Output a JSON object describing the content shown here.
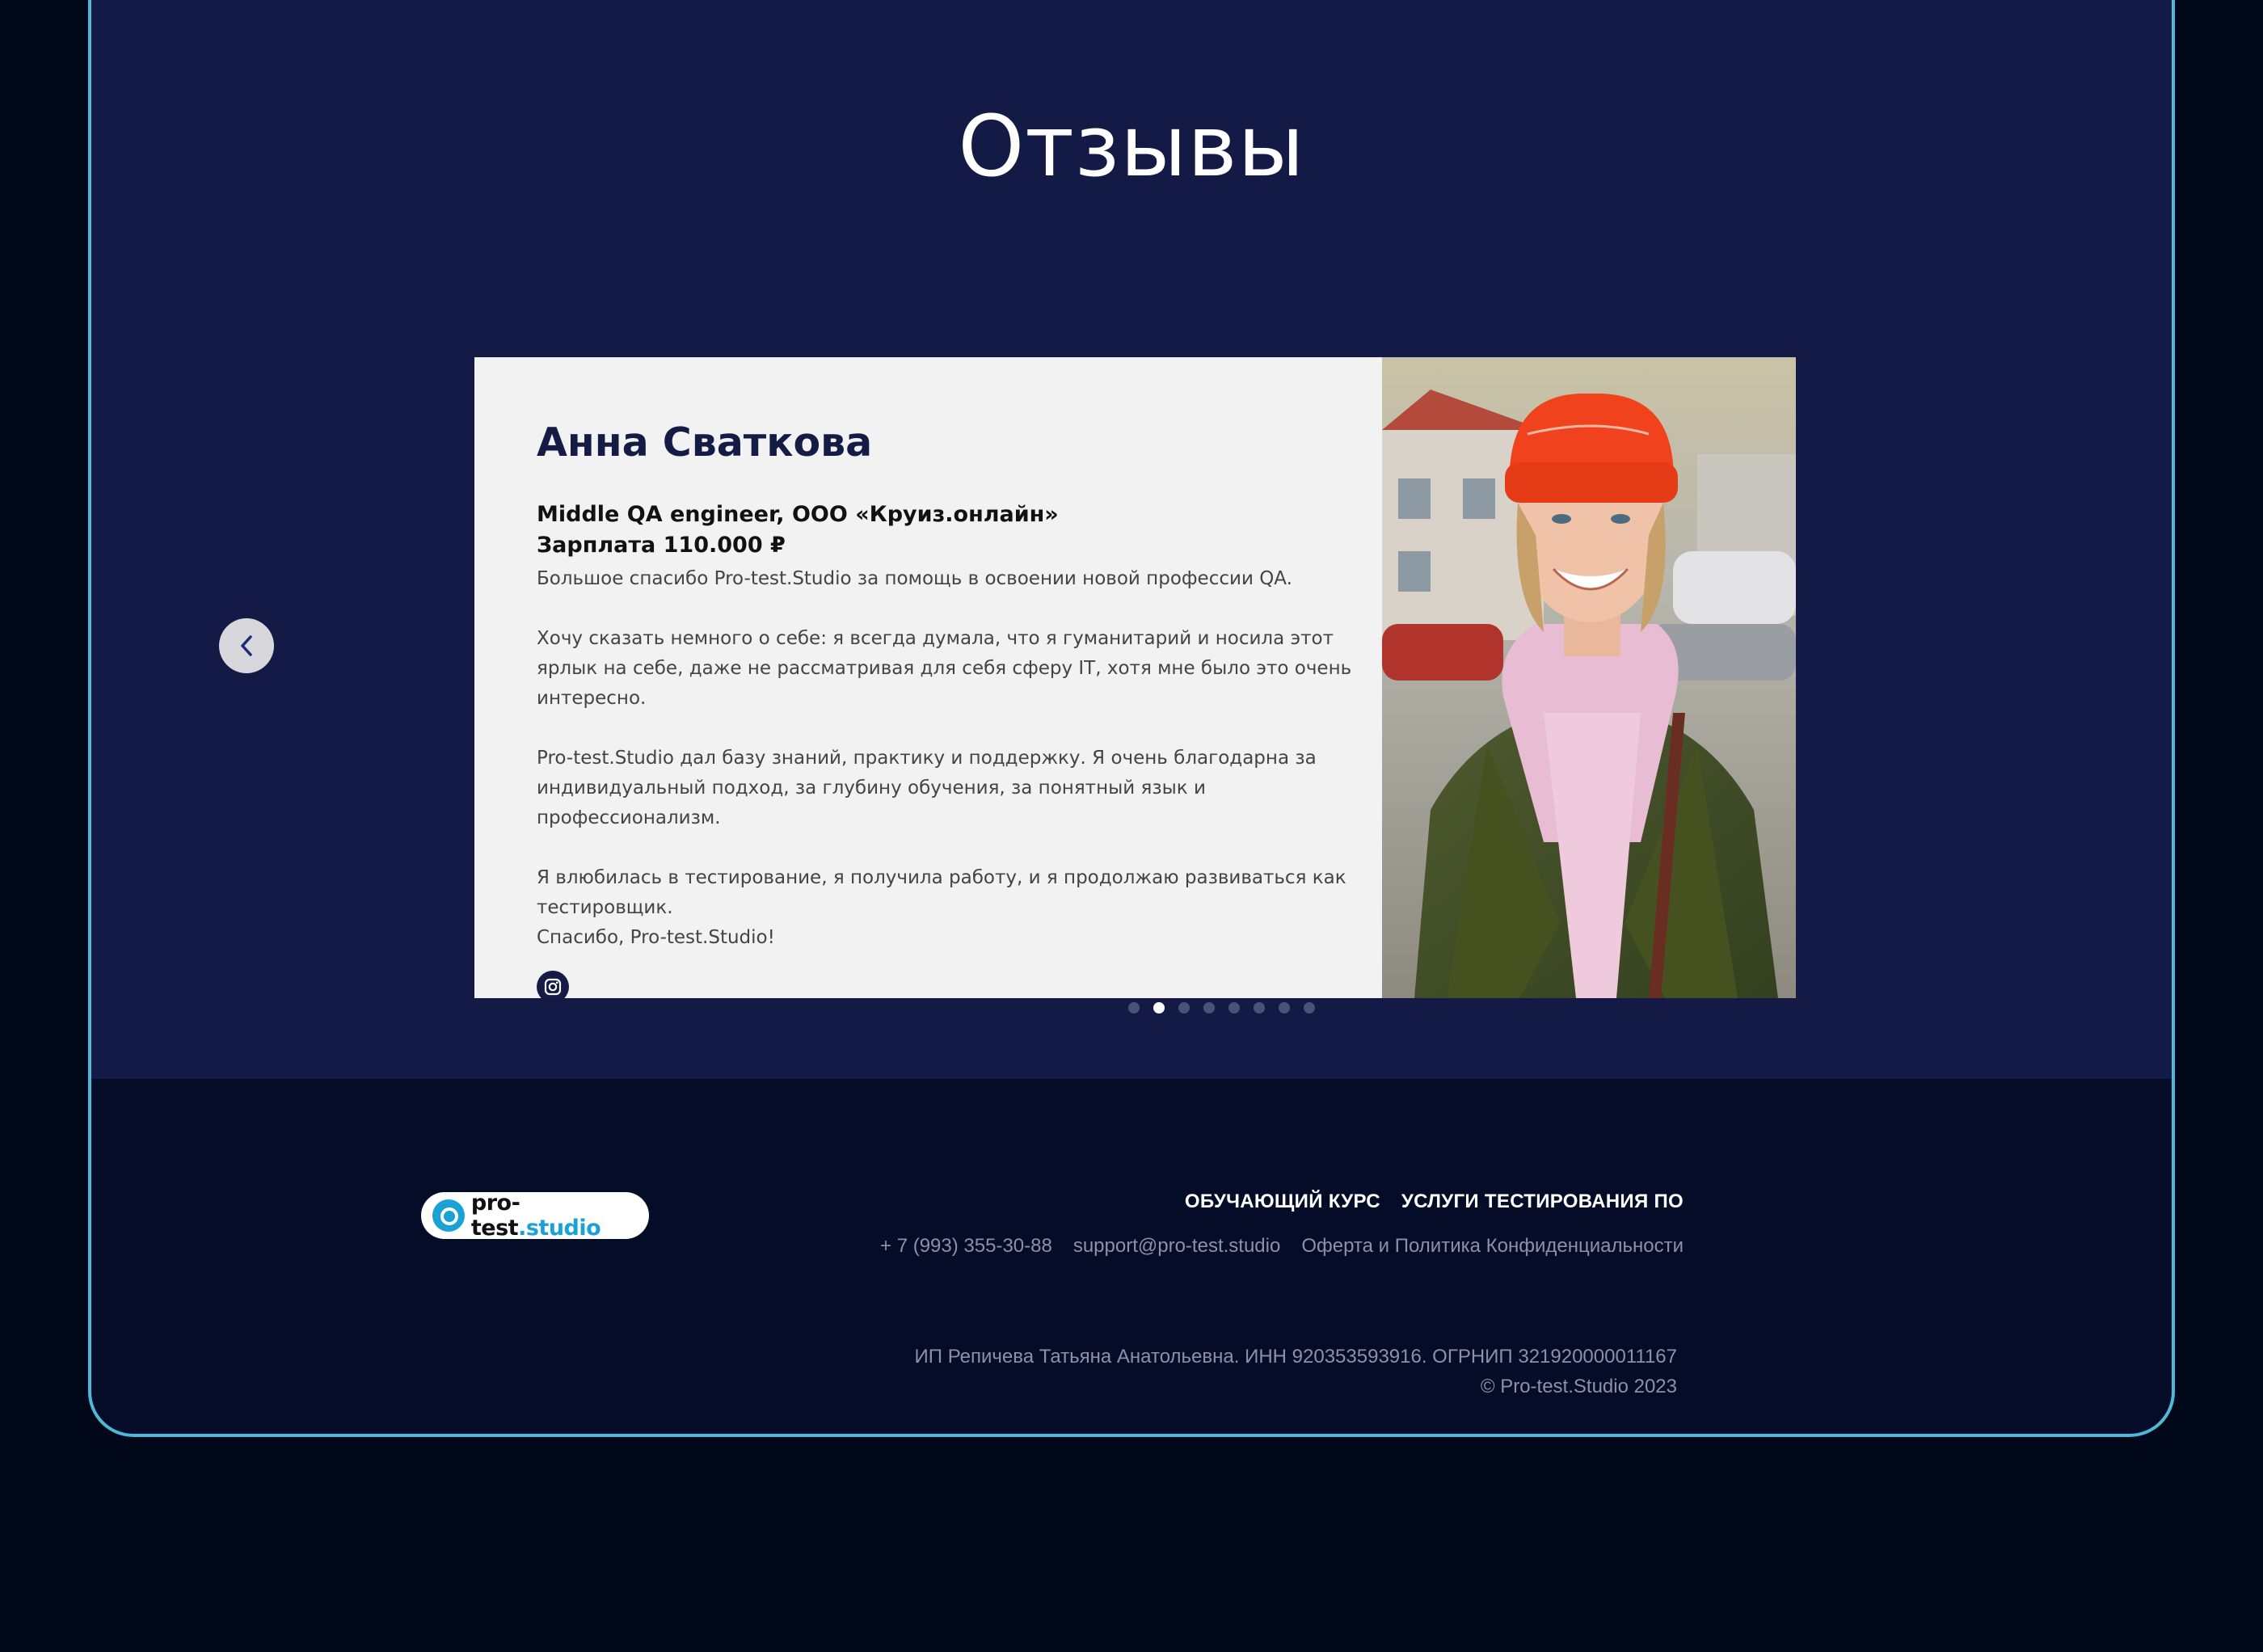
{
  "section": {
    "title": "Отзывы"
  },
  "review": {
    "name": "Анна Сваткова",
    "role": "Middle QA engineer, ООО «Круиз.онлайн»",
    "salary": "Зарплата 110.000 ₽",
    "paragraphs": [
      "Большое спасибо Pro-test.Studio за помощь в освоении новой профессии QA.",
      "Хочу сказать немного о себе: я всегда думала, что я гуманитарий и носила этот ярлык на себе, даже не рассматривая для себя сферу IT, хотя мне было это очень интересно.",
      "Pro-test.Studio дал базу знаний, практику и поддержку. Я очень благодарна за индивидуальный подход, за глубину обучения, за понятный язык и профессионализм.",
      "Я влюбилась в тестирование, я получила работу, и я продолжаю развиваться как тестировщик.",
      "Спасибо, Pro-test.Studio!"
    ],
    "social_icon": "instagram-icon"
  },
  "carousel": {
    "dot_count": 8,
    "active_index": 1,
    "prev_icon": "chevron-left-icon",
    "next_icon": "chevron-right-icon"
  },
  "footer": {
    "logo_text_main": "pro-test",
    "logo_text_accent": ".studio",
    "nav": [
      {
        "label": "ОБУЧАЮЩИЙ КУРС"
      },
      {
        "label": "УСЛУГИ ТЕСТИРОВАНИЯ ПО"
      }
    ],
    "contacts": {
      "phone": "+ 7 (993) 355-30-88",
      "email": "support@pro-test.studio",
      "policy": "Оферта и Политика Конфиденциальности"
    },
    "legal_line": "ИП Репичева Татьяна Анатольевна. ИНН 920353593916. ОГРНИП 321920000011167",
    "copyright": "© Pro-test.Studio 2023"
  },
  "colors": {
    "page_bg": "#010819",
    "section_bg": "#121a45",
    "frame_border": "#4fb7d9",
    "card_bg": "#f2f2f2",
    "accent": "#1aa2d6",
    "name_color": "#141b45"
  }
}
